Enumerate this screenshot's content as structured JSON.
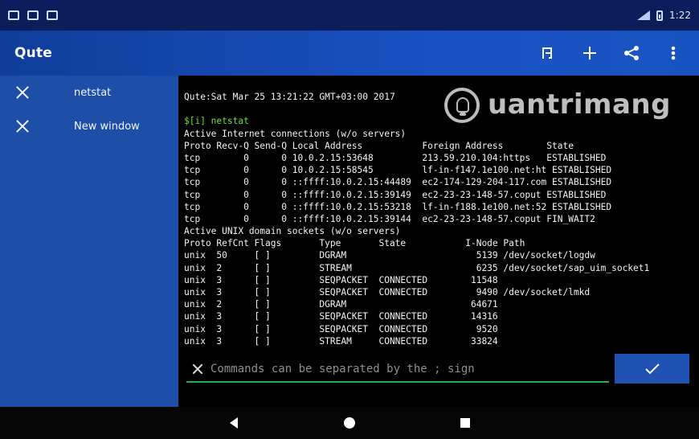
{
  "status_bar": {
    "time": "1:22",
    "left_icons": [
      "screen-icon",
      "sd-card-icon",
      "notification-icon"
    ],
    "right_icons": [
      "signal-icon",
      "battery-icon"
    ]
  },
  "app_bar": {
    "title": "Qute",
    "actions": [
      {
        "name": "run-icon"
      },
      {
        "name": "add-icon"
      },
      {
        "name": "share-icon"
      },
      {
        "name": "more-icon"
      }
    ]
  },
  "sidebar": {
    "tabs": [
      {
        "label": "netstat"
      },
      {
        "label": "New window"
      }
    ]
  },
  "terminal": {
    "watermark": "uantrimang",
    "lines": [
      {
        "text": "Qute:Sat Mar 25 13:21:22 GMT+03:00 2017"
      },
      {
        "text": ""
      },
      {
        "text": "$[i] netstat",
        "class": "green"
      },
      {
        "text": "Active Internet connections (w/o servers)"
      },
      {
        "text": "Proto Recv-Q Send-Q Local Address           Foreign Address        State"
      },
      {
        "text": "tcp        0      0 10.0.2.15:53648         213.59.210.104:https   ESTABLISHED"
      },
      {
        "text": "tcp        0      0 10.0.2.15:58545         lf-in-f147.1e100.net:ht ESTABLISHED"
      },
      {
        "text": "tcp        0      0 ::ffff:10.0.2.15:44489  ec2-174-129-204-117.com ESTABLISHED"
      },
      {
        "text": "tcp        0      0 ::ffff:10.0.2.15:39149  ec2-23-23-148-57.coput ESTABLISHED"
      },
      {
        "text": "tcp        0      0 ::ffff:10.0.2.15:53218  lf-in-f188.1e100.net:52 ESTABLISHED"
      },
      {
        "text": "tcp        0      0 ::ffff:10.0.2.15:39144  ec2-23-23-148-57.coput FIN_WAIT2"
      },
      {
        "text": "Active UNIX domain sockets (w/o servers)"
      },
      {
        "text": "Proto RefCnt Flags       Type       State           I-Node Path"
      },
      {
        "text": "unix  50     [ ]         DGRAM                        5139 /dev/socket/logdw"
      },
      {
        "text": "unix  2      [ ]         STREAM                       6235 /dev/socket/sap_uim_socket1"
      },
      {
        "text": "unix  3      [ ]         SEQPACKET  CONNECTED        11548"
      },
      {
        "text": "unix  3      [ ]         SEQPACKET  CONNECTED         9490 /dev/socket/lmkd"
      },
      {
        "text": "unix  2      [ ]         DGRAM                       64671"
      },
      {
        "text": "unix  3      [ ]         SEQPACKET  CONNECTED        14316"
      },
      {
        "text": "unix  3      [ ]         SEQPACKET  CONNECTED         9520"
      },
      {
        "text": "unix  3      [ ]         STREAM     CONNECTED        33824"
      }
    ]
  },
  "command_input": {
    "value": "",
    "placeholder": "Commands can be separated by the ; sign"
  },
  "submit_button": {
    "icon": "check-icon"
  },
  "nav_bar": {
    "buttons": [
      {
        "name": "back-icon"
      },
      {
        "name": "home-icon"
      },
      {
        "name": "recents-icon"
      }
    ]
  },
  "colors": {
    "status_bar": "#0b1d5b",
    "app_bar": "#1a52c4",
    "drawer": "#1e4fa8",
    "terminal_bg": "#000000",
    "terminal_text": "#f4f4f4",
    "accent_green": "#4dd13d",
    "submit_button": "#1f52b2"
  }
}
